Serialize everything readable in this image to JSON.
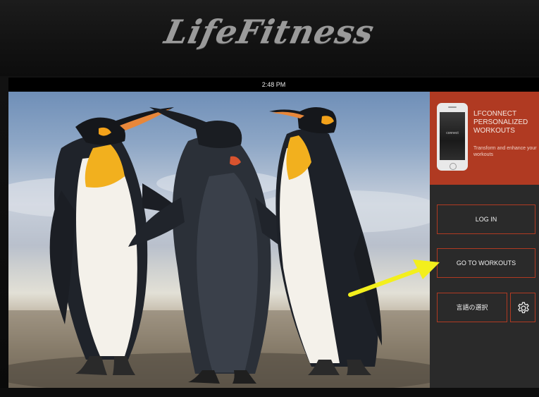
{
  "brand": {
    "logo_text": "LifeFitness"
  },
  "status_bar": {
    "time": "2:48 PM"
  },
  "promo": {
    "title": "LFCONNECT PERSONALIZED WORKOUTS",
    "subtitle": "Transform and enhance your workouts",
    "phone_logo_text": "connect"
  },
  "buttons": {
    "login": "LOG IN",
    "workouts": "GO TO WORKOUTS",
    "language": "言語の選択"
  },
  "icons": {
    "settings": "gear-icon",
    "annotation": "arrow-icon"
  },
  "colors": {
    "accent": "#b03a22",
    "annotation_arrow": "#f3ef1c"
  }
}
